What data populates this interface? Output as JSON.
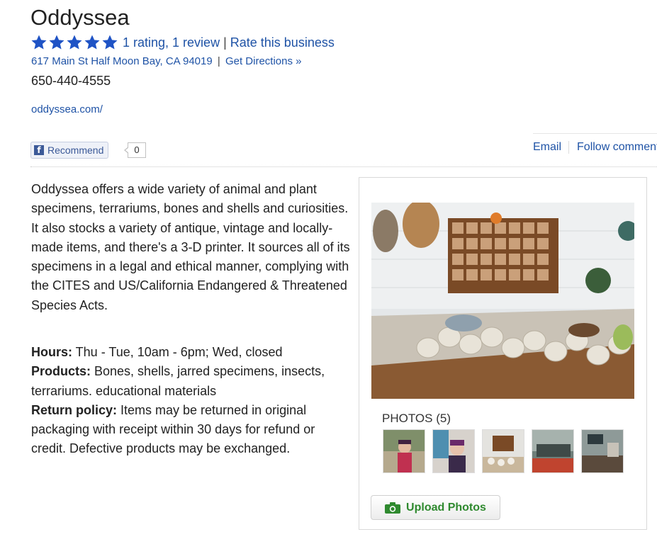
{
  "business": {
    "name": "Oddyssea",
    "rating_stars": 5,
    "rating_text": "1 rating, 1 review",
    "rate_link": "Rate this business",
    "address": "617 Main St Half Moon Bay, CA 94019",
    "directions_link": "Get Directions »",
    "phone": "650-440-4555",
    "website": "oddyssea.com/"
  },
  "social": {
    "recommend_label": "Recommend",
    "recommend_count": "0"
  },
  "actions": {
    "email": "Email",
    "follow": "Follow comments"
  },
  "description": "Oddyssea offers a wide variety of animal and plant specimens, terrariums, bones and shells and curiosities. It also stocks a variety of antique, vintage and locally-made items, and there's a 3-D printer. It sources all of its specimens in a legal and ethical manner, complying with the CITES and US/California Endangered & Threatened Species Acts.",
  "details": {
    "hours_label": "Hours:",
    "hours_value": " Thu - Tue, 10am - 6pm; Wed, closed",
    "products_label": "Products:",
    "products_value": " Bones, shells, jarred specimens, insects, terrariums. educational materials",
    "return_label": "Return policy:",
    "return_value": " Items may be returned in original packaging with receipt within 30 days for refund or credit. Defective products may be exchanged."
  },
  "photos": {
    "label": "PHOTOS (5)",
    "thumb_count": 5,
    "upload_label": "Upload Photos"
  },
  "colors": {
    "link": "#1f53a6",
    "star": "#1f53c5",
    "upload_text": "#2f8a2f",
    "facebook": "#3b5998"
  }
}
